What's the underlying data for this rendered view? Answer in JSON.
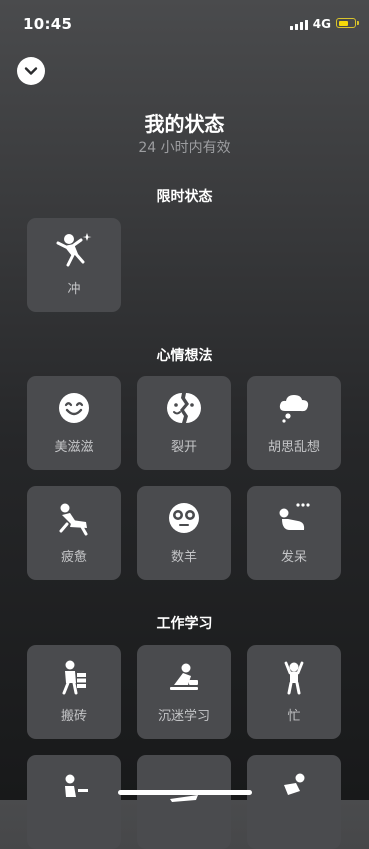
{
  "status_bar": {
    "time": "10:45",
    "network": "4G",
    "battery_level": 0.6,
    "battery_color": "#f5d90a"
  },
  "header": {
    "collapse_icon": "chevron-down-icon",
    "title": "我的状态",
    "subtitle": "24 小时内有效"
  },
  "sections": [
    {
      "title": "限时状态",
      "items": [
        {
          "label": "冲",
          "icon": "rush-icon"
        }
      ]
    },
    {
      "title": "心情想法",
      "items": [
        {
          "label": "美滋滋",
          "icon": "smile-face-icon"
        },
        {
          "label": "裂开",
          "icon": "cracked-face-icon"
        },
        {
          "label": "胡思乱想",
          "icon": "thought-bubble-icon"
        },
        {
          "label": "疲惫",
          "icon": "tired-person-icon"
        },
        {
          "label": "数羊",
          "icon": "sheep-face-icon"
        },
        {
          "label": "发呆",
          "icon": "daydream-icon"
        }
      ]
    },
    {
      "title": "工作学习",
      "items": [
        {
          "label": "搬砖",
          "icon": "carry-bricks-icon"
        },
        {
          "label": "沉迷学习",
          "icon": "study-icon"
        },
        {
          "label": "忙",
          "icon": "busy-icon"
        },
        {
          "label": "",
          "icon": "desk-person-icon"
        },
        {
          "label": "",
          "icon": "plane-icon"
        },
        {
          "label": "",
          "icon": "running-person-icon"
        }
      ]
    }
  ]
}
